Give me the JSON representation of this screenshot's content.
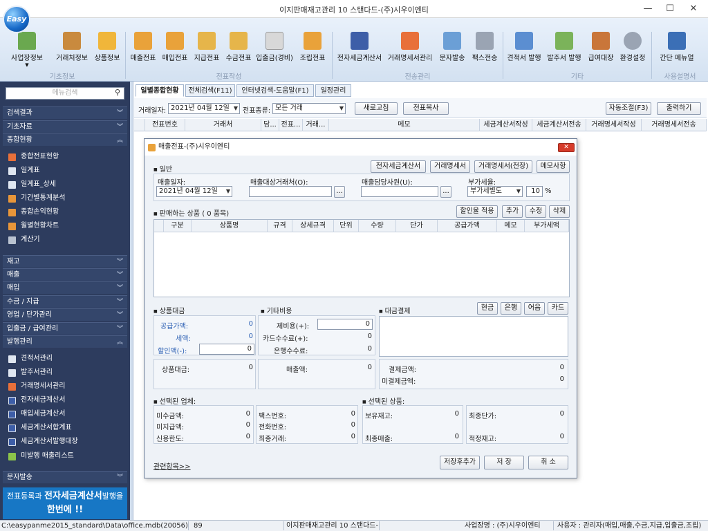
{
  "window": {
    "title": "이지판매재고관리 10 스탠다드-(주)시우이엔티",
    "logo_text": "Easy"
  },
  "ribbon": {
    "buttons": [
      "사업장정보",
      "거래처정보",
      "상품정보",
      "매출전표",
      "매입전표",
      "지급전표",
      "수금전표",
      "입출금(경비)",
      "조립전표",
      "전자세금계산서",
      "거래명세서관리",
      "문자발송",
      "팩스전송",
      "견적서 발행",
      "발주서 발행",
      "급여대장",
      "환경설정",
      "간단 메뉴얼"
    ],
    "groups": [
      "기초정보",
      "전표작성",
      "전송관리",
      "기타",
      "사용설명서"
    ]
  },
  "sidebar": {
    "search_placeholder": "메뉴검색",
    "headers": [
      "검색결과",
      "기초자료",
      "종합현황",
      "재고",
      "매출",
      "매입",
      "수금 / 지급",
      "영업 / 단가관리",
      "입출금 / 급여관리",
      "발행관리",
      "문자발송"
    ],
    "status_items": [
      "종합전표현황",
      "일계표",
      "일계표_상세",
      "기간별통계분석",
      "종합손익현황",
      "월별현황차트",
      "계산기"
    ],
    "issue_items": [
      "견적서관리",
      "발주서관리",
      "거래명세서관리",
      "전자세금계산서",
      "매입세금계산서",
      "세금계산서합계표",
      "세금계산서발행대장",
      "미발행 매출리스트"
    ],
    "promo_line1_a": "전표등록과 ",
    "promo_line1_b": "전자세금계산서",
    "promo_line1_c": "발행을",
    "promo_line2": "한번에 !!"
  },
  "tabs": [
    "일별종합현황",
    "전체검색(F11)",
    "인터넷검색-도움말(F1)",
    "일정관리"
  ],
  "filter": {
    "date_label": "거래일자:",
    "date_value": "2021년 04월 12일",
    "type_label": "전표종류:",
    "type_value": "모든 거래",
    "refresh_btn": "새로고침",
    "copy_btn": "전표복사",
    "autofit_btn": "자동조절(F3)",
    "print_btn": "출력하기"
  },
  "grid": {
    "columns": [
      "전표번호",
      "거래처",
      "담...",
      "전표...",
      "거래...",
      "메모",
      "세금계산서작성",
      "세금계산서전송",
      "거래명세서작성",
      "거래명세서전송"
    ]
  },
  "dialog": {
    "title": "매출전표-(주)시우이엔티",
    "section_general": "일반",
    "btn_etax": "전자세금계산서",
    "btn_stmt": "거래명세서",
    "btn_stmt_long": "거래명세서(전장)",
    "btn_memo": "메모사항",
    "sale_date_label": "매출일자:",
    "sale_date_value": "2021년 04월 12일",
    "customer_label": "매출대상거래처(O):",
    "manager_label": "매출담당사원(U):",
    "vat_label": "부가세율:",
    "vat_type": "부가세별도",
    "vat_rate": "10",
    "vat_unit": "%",
    "ellipsis": "...",
    "section_items": "판매하는 상품 ( 0 품목)",
    "btn_discount": "할인율 적용",
    "btn_add": "추가",
    "btn_edit": "수정",
    "btn_delete": "삭제",
    "item_columns": [
      "구분",
      "상품명",
      "규격",
      "상세규격",
      "단위",
      "수량",
      "단가",
      "공급가액",
      "메모",
      "부가세액"
    ],
    "section_price": "상품대금",
    "section_extra": "기타비용",
    "section_payment": "대금결제",
    "btn_cash": "현금",
    "btn_bank": "은행",
    "btn_bill": "어음",
    "btn_card": "카드",
    "supply_label": "공급가액:",
    "supply_value": "0",
    "tax_label": "세액:",
    "tax_value": "0",
    "discount_label": "할인액(-):",
    "discount_value": "0",
    "extra_cost_label": "제비용(+):",
    "extra_cost_value": "0",
    "card_fee_label": "카드수수료(+):",
    "card_fee_value": "0",
    "bank_fee_label": "은행수수료:",
    "bank_fee_value": "0",
    "goods_total_label": "상품대금:",
    "goods_total_value": "0",
    "sales_label": "매출액:",
    "sales_value": "0",
    "settled_label": "결제금액:",
    "settled_value": "0",
    "unsettled_label": "미결제금액:",
    "unsettled_value": "0",
    "section_company": "선택된 업체:",
    "section_product": "선택된 상품:",
    "receivable_label": "미수금액:",
    "receivable_value": "0",
    "payable_label": "미지급액:",
    "payable_value": "0",
    "credit_label": "신용한도:",
    "credit_value": "0",
    "fax_label": "팩스번호:",
    "fax_value": "0",
    "phone_label": "전화번호:",
    "phone_value": "0",
    "last_trade_label": "최종거래:",
    "last_trade_value": "0",
    "stock_label": "보유재고:",
    "stock_value": "0",
    "last_price_label": "최종단가:",
    "last_price_value": "0",
    "last_sale_label": "최종매출:",
    "last_sale_value": "0",
    "proper_stock_label": "적정재고:",
    "proper_stock_value": "0",
    "related_link": "관련항목>>",
    "btn_save_add": "저장후추가",
    "btn_save": "저 장",
    "btn_cancel": "취 소"
  },
  "status": {
    "path": "C:\\easypanme2015_standard\\Data\\office.mdb(20056)",
    "code": "89",
    "product": "이지판매재고관리 10 스탠다드-",
    "business": "사업장명 : (주)시우이엔티",
    "user": "사용자 : 관리자(매입,매출,수금,지급,입출금,조립)"
  },
  "colors": {
    "sidebar": "#2d3c5e",
    "accent": "#1777c5",
    "link": "#2b5fb3",
    "close": "#d63c2b"
  }
}
